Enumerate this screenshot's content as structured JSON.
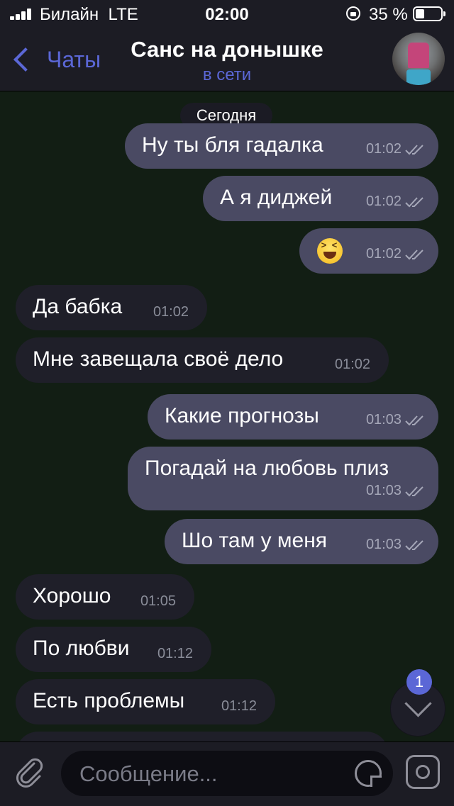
{
  "status_bar": {
    "carrier": "Билайн",
    "network": "LTE",
    "time": "02:00",
    "battery_percent": "35 %"
  },
  "header": {
    "back_label": "Чаты",
    "chat_title": "Санс на донышке",
    "status": "в сети",
    "accent_color": "#5b67d6"
  },
  "chat": {
    "date_separator": "Сегодня",
    "messages": [
      {
        "direction": "out",
        "text": "Ну ты бля гадалка",
        "time": "01:02",
        "read": true
      },
      {
        "direction": "out",
        "text": "А я диджей",
        "time": "01:02",
        "read": true
      },
      {
        "direction": "out",
        "emoji": "grinning-squinting-face",
        "time": "01:02",
        "read": true
      },
      {
        "direction": "in",
        "text": "Да бабка",
        "time": "01:02"
      },
      {
        "direction": "in",
        "text": "Мне завещала своё дело",
        "time": "01:02"
      },
      {
        "direction": "out",
        "text": "Какие прогнозы",
        "time": "01:03",
        "read": true
      },
      {
        "direction": "out",
        "text": "Погадай на любовь плиз",
        "time": "01:03",
        "read": true
      },
      {
        "direction": "out",
        "text": "Шо там у меня",
        "time": "01:03",
        "read": true
      },
      {
        "direction": "in",
        "text": "Хорошо",
        "time": "01:05"
      },
      {
        "direction": "in",
        "text": "По любви",
        "time": "01:12"
      },
      {
        "direction": "in",
        "text": "Есть проблемы",
        "time": "01:12"
      }
    ],
    "unread_badge": "1"
  },
  "input_bar": {
    "placeholder": "Сообщение...",
    "icons": [
      "paperclip-icon",
      "sticker-icon",
      "camera-icon"
    ]
  }
}
